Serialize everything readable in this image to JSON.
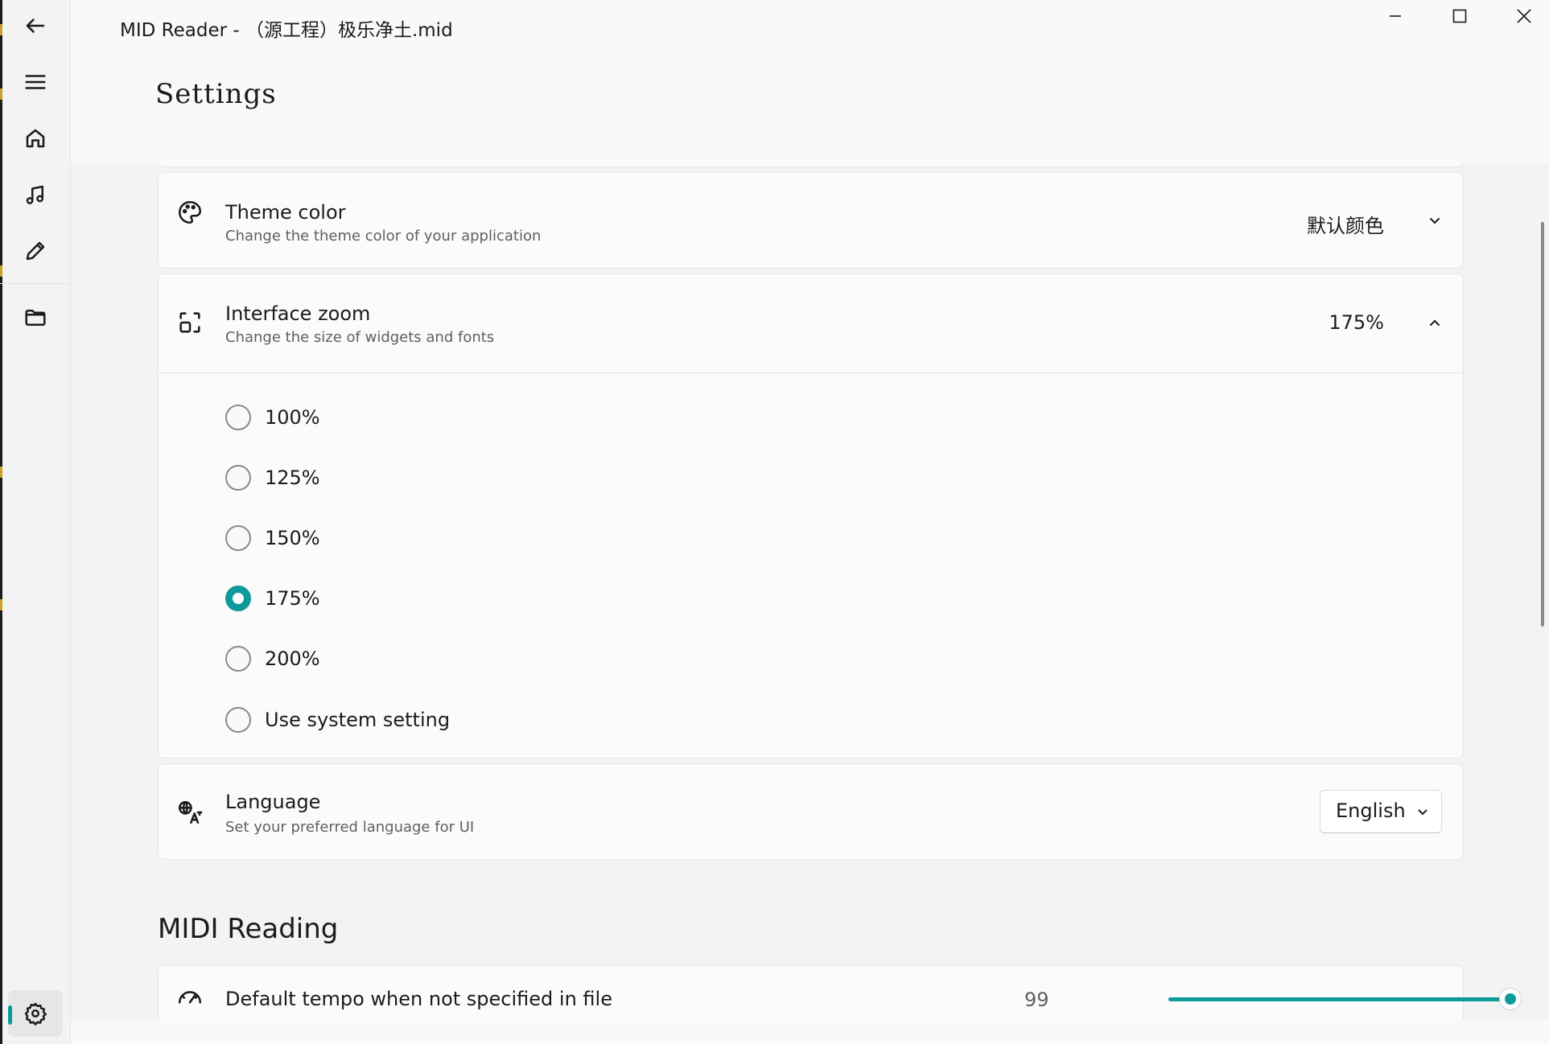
{
  "window": {
    "title": "MID Reader - （源工程）极乐净土.mid",
    "controls": [
      "minimize",
      "maximize",
      "close"
    ]
  },
  "nav": {
    "items": [
      {
        "icon": "back-arrow-icon"
      },
      {
        "icon": "hamburger-menu-icon"
      },
      {
        "icon": "home-icon"
      },
      {
        "icon": "music-note-icon"
      },
      {
        "icon": "pencil-icon"
      },
      {
        "icon": "folder-icon"
      },
      {
        "icon": "gear-icon",
        "active": true
      }
    ]
  },
  "header": {
    "title": "Settings"
  },
  "settings": {
    "theme_color": {
      "title": "Theme color",
      "subtitle": "Change the theme color of your application",
      "value": "默认颜色",
      "icon": "palette-icon"
    },
    "interface_zoom": {
      "title": "Interface zoom",
      "subtitle": "Change the size of widgets and fonts",
      "value": "175%",
      "icon": "zoom-fit-icon",
      "expanded": true,
      "options": [
        {
          "label": "100%",
          "checked": false
        },
        {
          "label": "125%",
          "checked": false
        },
        {
          "label": "150%",
          "checked": false
        },
        {
          "label": "175%",
          "checked": true
        },
        {
          "label": "200%",
          "checked": false
        },
        {
          "label": "Use system setting",
          "checked": false
        }
      ]
    },
    "language": {
      "title": "Language",
      "subtitle": "Set your preferred language for UI",
      "value": "English",
      "icon": "translate-icon"
    }
  },
  "midi_reading": {
    "section_title": "MIDI Reading",
    "default_tempo": {
      "title": "Default tempo when not specified in file",
      "value": "99",
      "slider_fraction": 1.0,
      "icon": "metronome-icon"
    }
  },
  "colors": {
    "accent": "#0e9a9a",
    "background": "#f3f3f3",
    "card": "#fbfbfb"
  }
}
